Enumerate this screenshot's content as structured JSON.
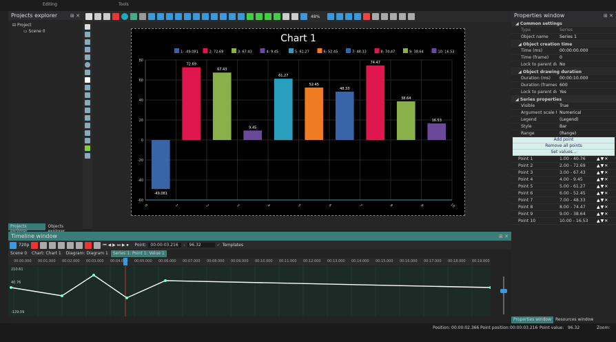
{
  "menu": {
    "tabs": [
      "Editing",
      "Tools"
    ]
  },
  "projects_explorer": {
    "title": "Projects explorer",
    "tree": [
      "Project",
      "Scene 0"
    ],
    "tabs": [
      "Projects explorer",
      "Objects explorer"
    ]
  },
  "chart": {
    "title": "Chart 1"
  },
  "chart_data": {
    "type": "bar",
    "title": "Chart 1",
    "categories": [
      "0",
      "1",
      "2",
      "3",
      "4",
      "5",
      "6",
      "7",
      "8",
      "9",
      "10"
    ],
    "series": [
      {
        "values": [
          -49.081,
          72.69,
          67.43,
          9.45,
          61.27,
          52.45,
          48.33,
          74.47,
          38.64,
          16.53
        ]
      }
    ],
    "legend": [
      "1: -49.081",
      "2: 72.69",
      "3: 67.43",
      "4: 9.45",
      "5: 61.27",
      "6: 52.45",
      "7: 48.33",
      "8: 74.47",
      "9: 38.64",
      "10: 16.53"
    ],
    "data_labels": [
      "-49.081",
      "72.69",
      "67.43",
      "9.45",
      "61.27",
      "52.45",
      "48.33",
      "74.47",
      "38.64",
      "16.53"
    ],
    "colors": [
      "#3a64a8",
      "#e0174f",
      "#8ab04a",
      "#6a4a98",
      "#2aa0be",
      "#ef7b22",
      "#3a64a8",
      "#e0174f",
      "#8ab04a",
      "#6a4a98"
    ],
    "ylim": [
      -60,
      80
    ],
    "yticks": [
      "80",
      "60",
      "40",
      "20",
      "0",
      "-20",
      "-40",
      "-60"
    ],
    "grid": true,
    "legend_position": "top"
  },
  "properties": {
    "title": "Properties window",
    "common": "Common settings",
    "type": {
      "k": "Type",
      "v": "Series"
    },
    "object_name": {
      "k": "Object name",
      "v": "Series 1"
    },
    "creation": "Object creation time",
    "time_ms": {
      "k": "Time (ms)",
      "v": "00:00:00.000"
    },
    "time_frame": {
      "k": "Time (frame)",
      "v": "0"
    },
    "lock_parent": {
      "k": "Lock to parent dur.",
      "v": "No"
    },
    "drawing": "Object drawing duration",
    "dur_ms": {
      "k": "Duration (ms)",
      "v": "00:00:10.000"
    },
    "dur_frames": {
      "k": "Duration (frames)",
      "v": "600"
    },
    "lock_parent2": {
      "k": "Lock to parent dur.",
      "v": "Yes"
    },
    "series_props": "Series properties",
    "visible": {
      "k": "Visible",
      "v": "True"
    },
    "arg_scale": {
      "k": "Argument scale type",
      "v": "Numerical"
    },
    "legend": {
      "k": "Legend",
      "v": "(Legend)"
    },
    "style": {
      "k": "Style",
      "v": "Bar"
    },
    "range": {
      "k": "Range",
      "v": "(Range)"
    },
    "add_point": "Add point",
    "remove_all": "Remove all points",
    "set_values": "Set values...",
    "points": [
      {
        "k": "Point 1",
        "v": "1.00 - 40.76"
      },
      {
        "k": "Point 2",
        "v": "2.00 - 72.69"
      },
      {
        "k": "Point 3",
        "v": "3.00 - 67.43"
      },
      {
        "k": "Point 4",
        "v": "4.00 - 9.45"
      },
      {
        "k": "Point 5",
        "v": "5.00 - 61.27"
      },
      {
        "k": "Point 6",
        "v": "6.00 - 52.45"
      },
      {
        "k": "Point 7",
        "v": "7.00 - 48.33"
      },
      {
        "k": "Point 8",
        "v": "8.00 - 74.47"
      },
      {
        "k": "Point 9",
        "v": "9.00 - 38.64"
      },
      {
        "k": "Point 10",
        "v": "10.00 - 16.53"
      }
    ],
    "tabs": [
      "Properties window",
      "Resources window"
    ]
  },
  "toolbar": {
    "zoom": "48%"
  },
  "timeline": {
    "title": "Timeline window",
    "fps": "720p",
    "point_label": "Point:",
    "point_time": "00:00:03.216",
    "point_value": "96.32",
    "templates": "Templates",
    "tabs": [
      "Scene 0",
      "Chart: Chart 1",
      "Diagram: Diagram 1",
      "Series 1: Point 1: Value 1"
    ],
    "ruler": [
      "00:00.000",
      "00:01.000",
      "00:02.000",
      "00:03.000",
      "00:04.000",
      "00:05.000",
      "00:06.000",
      "00:07.000",
      "00:08.000",
      "00:09.000",
      "00:10.000",
      "00:11.000",
      "00:12.000",
      "00:13.000",
      "00:14.000",
      "00:15.000",
      "00:16.000",
      "00:17.000",
      "00:18.000",
      "00:19.000"
    ],
    "ymax": "210.61",
    "ymid": "40.76",
    "ymin": "-129.09"
  },
  "status": {
    "position_label": "Position:",
    "position": "00:00:02.366",
    "point_position_label": "Point position:",
    "point_position": "00:00:03.216",
    "point_value_label": "Point value:",
    "point_value": "96.32",
    "zoom_label": "Zoom:"
  }
}
